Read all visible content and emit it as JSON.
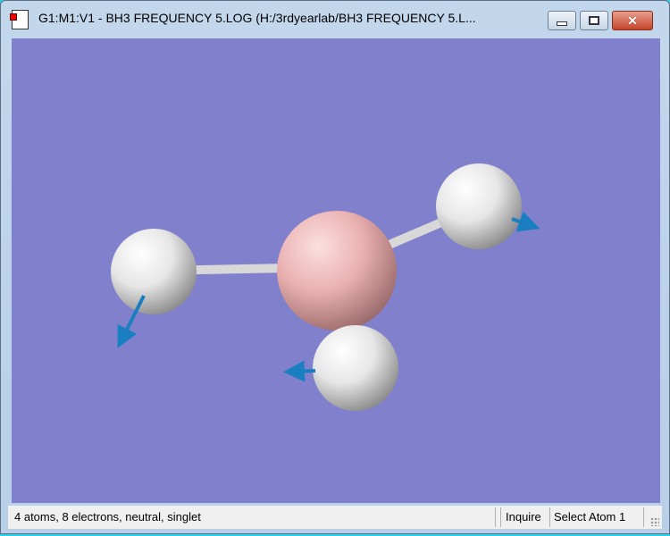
{
  "window": {
    "title": "G1:M1:V1 - BH3 FREQUENCY 5.LOG (H:/3rdyearlab/BH3 FREQUENCY 5.L...",
    "icon": "document-icon",
    "controls": {
      "minimize": "minimize-icon",
      "maximize": "maximize-icon",
      "close": "close-icon"
    }
  },
  "viewport": {
    "background_color": "#8080cc",
    "atom_colors": {
      "boron": "#f0b4b4",
      "hydrogen": "#f0f0f0"
    },
    "vector_color": "#1a7fc0"
  },
  "statusbar": {
    "info": "4 atoms, 8 electrons, neutral, singlet",
    "mode": "Inquire",
    "action": "Select Atom 1"
  }
}
